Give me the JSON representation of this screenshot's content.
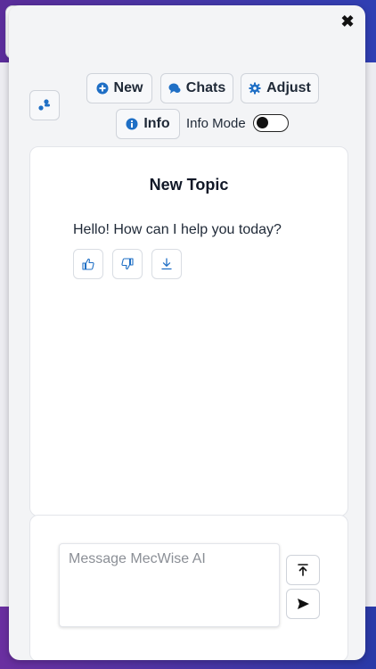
{
  "colors": {
    "accent": "#1f6fc5",
    "panel_bg": "#f3f4f6",
    "text": "#1f2937"
  },
  "header": {
    "close_icon": "close-icon",
    "sidebar_toggle_icon": "sidebar-dots-icon"
  },
  "toolbar": {
    "new_label": "New",
    "new_icon": "plus-circle-icon",
    "chats_label": "Chats",
    "chats_icon": "chat-bubbles-icon",
    "adjust_label": "Adjust",
    "adjust_icon": "gear-icon",
    "info_label": "Info",
    "info_icon": "info-circle-icon",
    "info_mode_label": "Info Mode",
    "info_mode_on": false
  },
  "chat": {
    "title": "New Topic",
    "messages": [
      {
        "role": "assistant",
        "text": "Hello! How can I help you today?",
        "actions": [
          "thumbs-up-icon",
          "thumbs-down-icon",
          "download-icon"
        ]
      }
    ]
  },
  "composer": {
    "placeholder": "Message MecWise AI",
    "value": "",
    "upload_icon": "upload-icon",
    "send_icon": "send-icon"
  }
}
